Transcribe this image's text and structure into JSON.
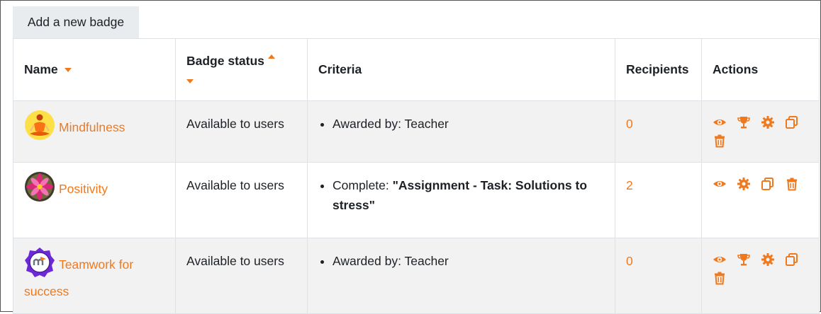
{
  "toolbar": {
    "add_badge_label": "Add a new badge"
  },
  "table": {
    "headers": {
      "name": "Name",
      "status": "Badge status",
      "criteria": "Criteria",
      "recipients": "Recipients",
      "actions": "Actions"
    },
    "rows": [
      {
        "name": "Mindfulness",
        "status": "Available to users",
        "criteria_prefix": "Awarded by: Teacher",
        "criteria_bold": "",
        "recipients": "0",
        "actions": [
          "view-icon",
          "award-icon",
          "gear-icon",
          "copy-icon",
          "trash-icon"
        ]
      },
      {
        "name": "Positivity",
        "status": "Available to users",
        "criteria_prefix": "Complete: ",
        "criteria_bold": "\"Assignment - Task: Solutions to stress\"",
        "recipients": "2",
        "actions": [
          "view-icon",
          "gear-icon",
          "copy-icon",
          "trash-icon"
        ]
      },
      {
        "name": "Teamwork for success",
        "status": "Available to users",
        "criteria_prefix": "Awarded by: Teacher",
        "criteria_bold": "",
        "recipients": "0",
        "actions": [
          "view-icon",
          "award-icon",
          "gear-icon",
          "copy-icon",
          "trash-icon"
        ]
      }
    ]
  },
  "colors": {
    "accent": "#f0791e",
    "header_button_bg": "#e9ecef",
    "odd_row_bg": "#f2f2f2"
  }
}
